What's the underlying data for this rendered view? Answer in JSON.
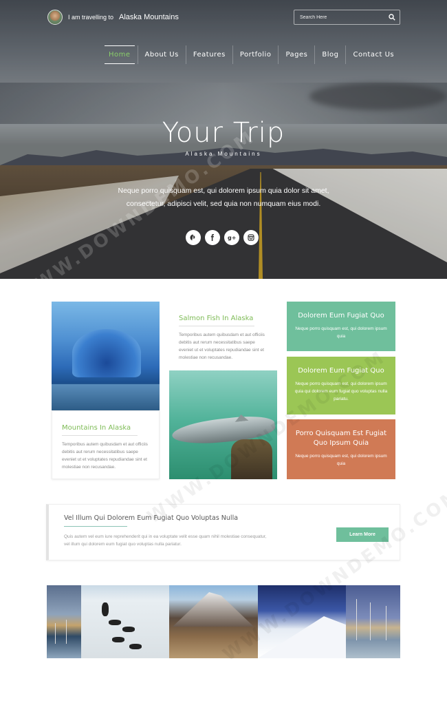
{
  "brand": {
    "prefix": "I am travelling to",
    "destination": "Alaska Mountains"
  },
  "search": {
    "placeholder": "Search Here"
  },
  "nav": {
    "items": [
      {
        "label": "Home",
        "active": true
      },
      {
        "label": "About Us"
      },
      {
        "label": "Features"
      },
      {
        "label": "Portfolio"
      },
      {
        "label": "Pages"
      },
      {
        "label": "Blog"
      },
      {
        "label": "Contact Us"
      }
    ]
  },
  "hero": {
    "title": "Your Trip",
    "subtitle": "Alaska Mountains",
    "text": "Neque porro quisquam est, qui dolorem ipsum quia dolor sit amet, consectetur, adipisci velit, sed quia non numquam eius modi.",
    "social": [
      "pinterest-icon",
      "facebook-icon",
      "google-plus-icon",
      "instagram-icon"
    ]
  },
  "features": {
    "mountains": {
      "title": "Mountains In Alaska",
      "text": "Temporibus autem quibusdam et aut officiis debitis aut rerum necessitatibus saepe eveniet ut et voluptates repudiandae sint et molestiae non recusandae."
    },
    "salmon": {
      "title": "Salmon Fish In Alaska",
      "text": "Temporibus autem quibusdam et aut officiis debitis aut rerum necessitatibus saepe eveniet ut et voluptates repudiandae sint et molestiae non recusandae."
    },
    "panels": [
      {
        "title": "Dolorem Eum Fugiat Quo",
        "text": "Neque porro quisquam est, qui dolorem ipsum quia",
        "color": "#6fbf9c"
      },
      {
        "title": "Dolorem Eum Fugiat Quo",
        "text": "Neque porro quisquam est, qui dolorem ipsum quia qui dolorem eum fugiat quo voluptas nulla pariatu.",
        "color": "#9bc655"
      },
      {
        "title": "Porro Quisquam Est Fugiat Quo Ipsum Quia",
        "text": "Neque porro quisquam est, qui dolorem ipsum quia",
        "color": "#d07a55"
      }
    ]
  },
  "cta": {
    "title": "Vel Illum Qui Dolorem Eum Fugiat Quo Voluptas Nulla",
    "text": "Quis autem vel eum iure reprehenderit qui in ea voluptate velit esse quam nihil molestiae consequatur, vel illum qui dolorem eum fugiat quo voluptas nulla pariatur.",
    "button": "Learn More"
  },
  "watermark": "WWW.DOWNDEMO.COM"
}
